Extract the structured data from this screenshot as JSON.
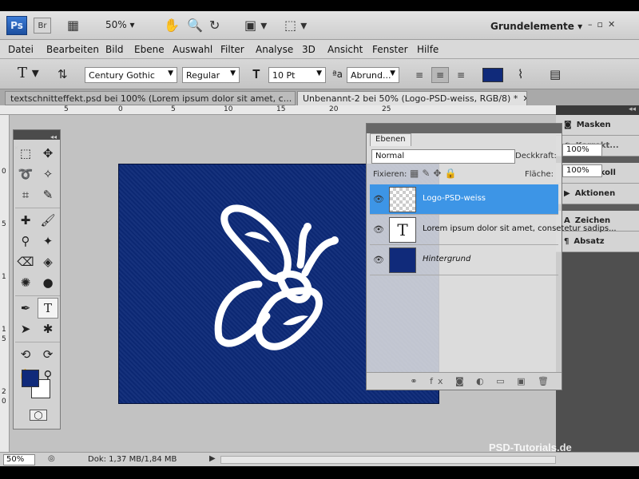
{
  "app": {
    "logo": "Ps",
    "bridge": "Br",
    "zoom": "50%",
    "workspace": "Grundelemente"
  },
  "menu": [
    "Datei",
    "Bearbeiten",
    "Bild",
    "Ebene",
    "Auswahl",
    "Filter",
    "Analyse",
    "3D",
    "Ansicht",
    "Fenster",
    "Hilfe"
  ],
  "options": {
    "font_family": "Century Gothic",
    "font_style": "Regular",
    "font_size": "10 Pt",
    "antialias": "Abrund...",
    "text_color": "#102a7a"
  },
  "tabs": [
    {
      "label": "textschnitteffekt.psd bei 100% (Lorem ipsum dolor sit amet, c...",
      "active": false
    },
    {
      "label": "Unbenannt-2 bei 50% (Logo-PSD-weiss, RGB/8) *",
      "active": true
    }
  ],
  "ruler": {
    "top": [
      "5",
      "0",
      "5",
      "10",
      "15",
      "20",
      "25"
    ],
    "left": [
      "0",
      "5",
      "1",
      "1",
      "5",
      "2",
      "0"
    ]
  },
  "layers_panel": {
    "tab": "Ebenen",
    "blend_mode": "Normal",
    "opacity_label": "Deckkraft:",
    "opacity": "100%",
    "fix_label": "Fixieren:",
    "fill_label": "Fläche:",
    "fill": "100%",
    "layers": [
      {
        "name": "Logo-PSD-weiss",
        "selected": true,
        "thumb": "checker"
      },
      {
        "name": "Lorem ipsum dolor sit amet, consetetur sadips...",
        "selected": false,
        "thumb": "text",
        "thumb_glyph": "T"
      },
      {
        "name": "Hintergrund",
        "selected": false,
        "thumb": "blue"
      }
    ]
  },
  "dock": {
    "items": [
      {
        "label": "Masken",
        "icon": "masks-icon"
      },
      {
        "label": "Korrekt...",
        "icon": "adjustments-icon"
      },
      {
        "label": "Protokoll",
        "icon": "history-icon"
      },
      {
        "label": "Aktionen",
        "icon": "actions-icon"
      },
      {
        "label": "Zeichen",
        "icon": "character-icon"
      },
      {
        "label": "Absatz",
        "icon": "paragraph-icon"
      }
    ]
  },
  "status": {
    "zoom": "50%",
    "doc_info": "Dok: 1,37 MB/1,84 MB"
  },
  "watermark": "PSD-Tutorials.de",
  "colors": {
    "foreground": "#102a7a",
    "background": "#ffffff",
    "selection": "#3d95e6",
    "document": "#0d2a78"
  }
}
